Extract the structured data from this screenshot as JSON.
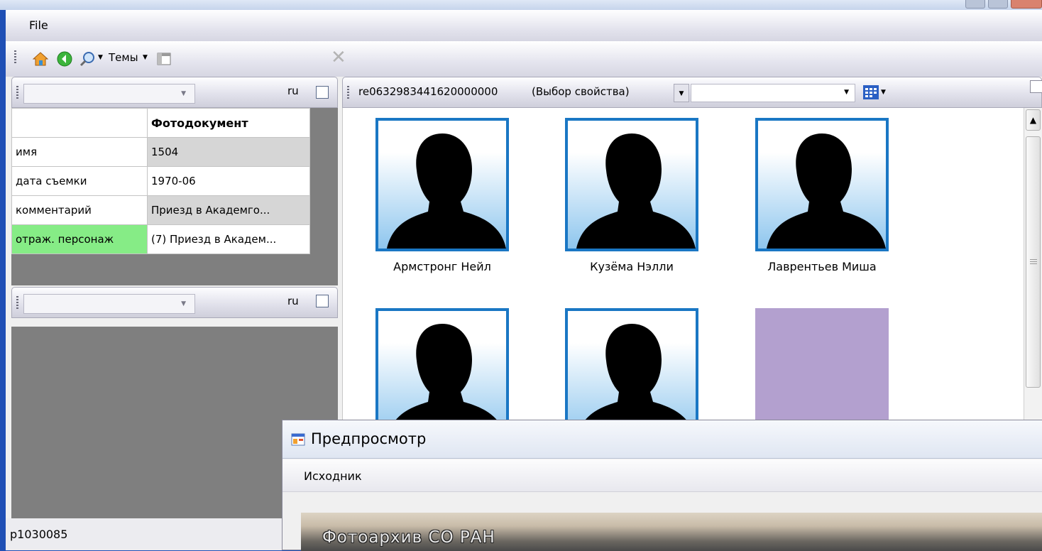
{
  "menu": {
    "file": "File"
  },
  "toolbar": {
    "themes": "Темы"
  },
  "left_top": {
    "lang": "ru"
  },
  "properties": {
    "header": "Фотодокумент",
    "rows": [
      {
        "key": "имя",
        "value": "1504"
      },
      {
        "key": "дата съемки",
        "value": "1970-06"
      },
      {
        "key": "комментарий",
        "value": "Приезд в Академго..."
      },
      {
        "key": "отраж. персонаж",
        "value": "(7) Приезд в Академ..."
      }
    ]
  },
  "left_bottom": {
    "lang": "ru"
  },
  "status": {
    "id": "p1030085"
  },
  "right_toolbar": {
    "record_id": "re0632983441620000000",
    "property_select": "(Выбор свойства)"
  },
  "gallery": {
    "items": [
      {
        "name": "Армстронг Нейл"
      },
      {
        "name": "Кузёма Нэлли"
      },
      {
        "name": "Лаврентьев Миша"
      }
    ],
    "placeholder_color": "#b3a0cf"
  },
  "preview": {
    "title": "Предпросмотр",
    "menu_item": "Исходник",
    "watermark": "Фотоархив СО РАН"
  },
  "colors": {
    "desktop": "#1f4fb5",
    "tile_border": "#1a77c4",
    "selected_key": "#86ec86"
  }
}
